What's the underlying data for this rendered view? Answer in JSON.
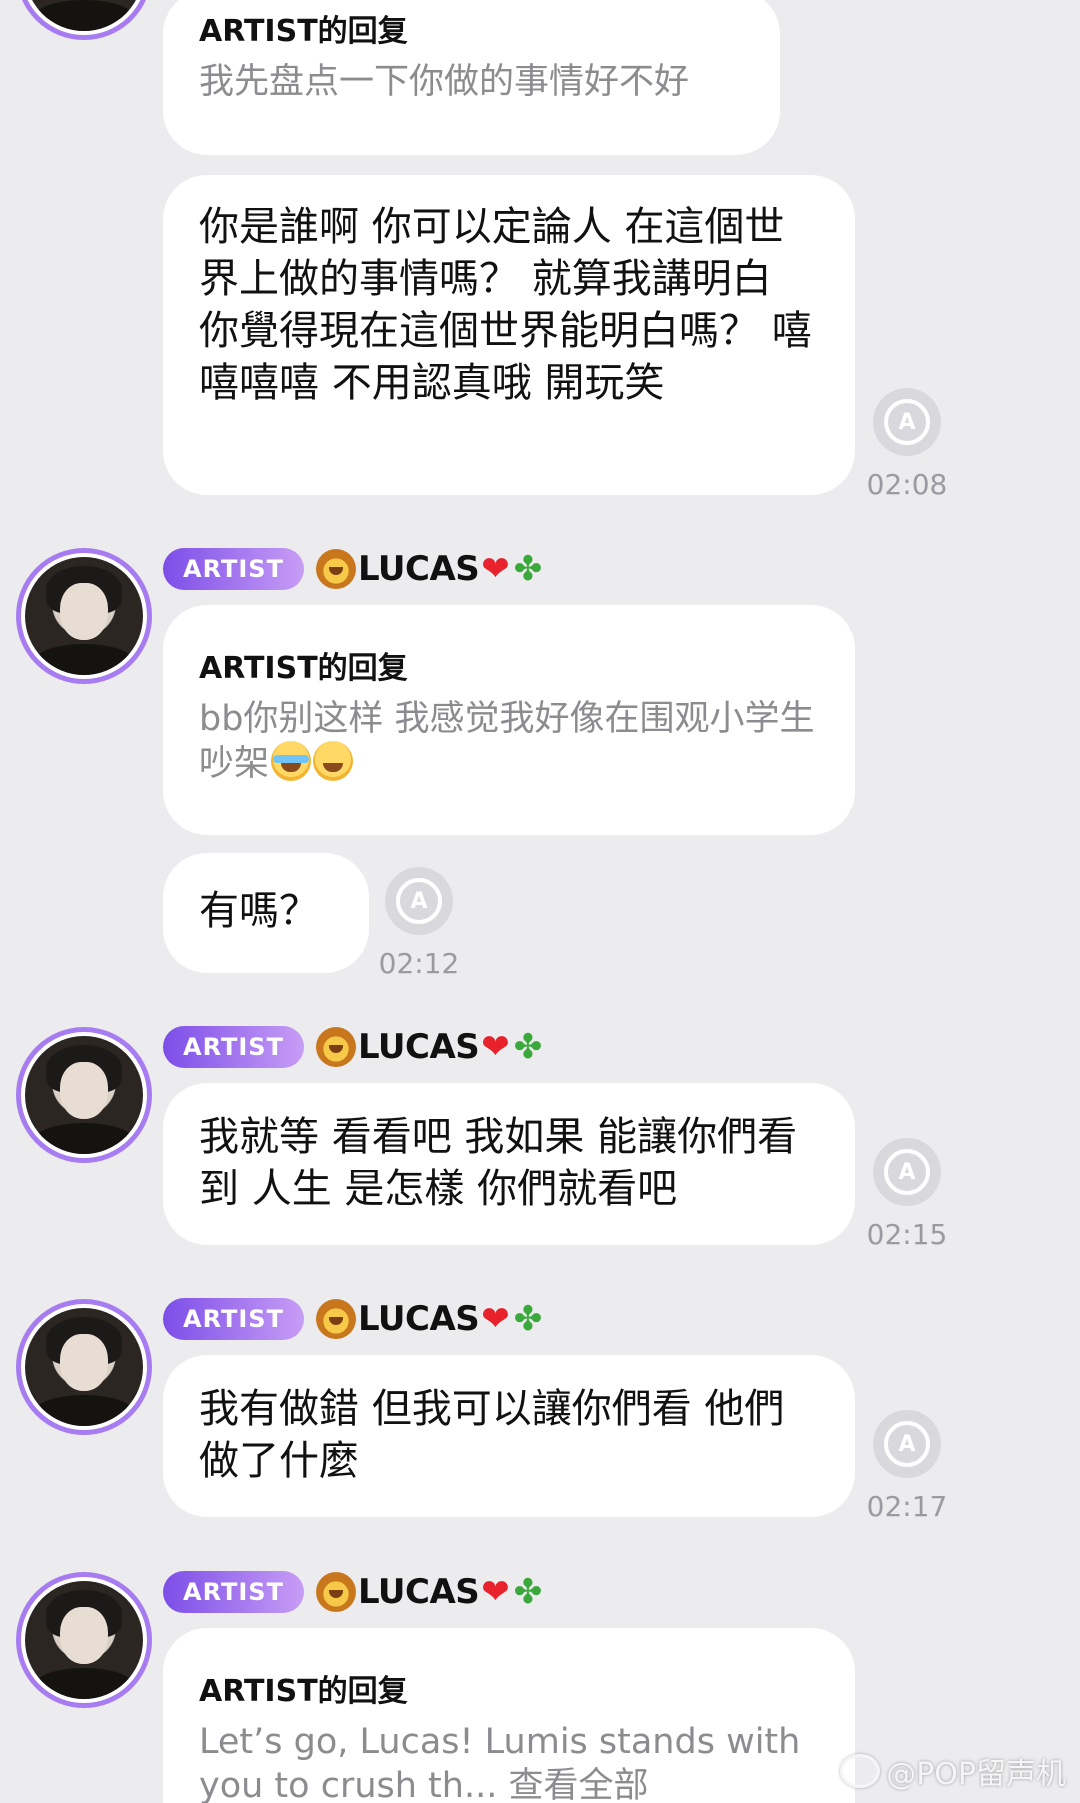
{
  "sender": {
    "badge": "ARTIST",
    "name": "LUCAS",
    "icons": [
      "lion-emoji",
      "red-heart-emoji",
      "four-leaf-clover-emoji"
    ],
    "avatar_ring_color": "#a77cf0"
  },
  "messages": [
    {
      "reply_title": "ARTIST的回复",
      "reply_body": "我先盘点一下你做的事情好不好"
    },
    {
      "text": "你是誰啊 你可以定論人 在這個世界上做的事情嗎？ 就算我講明白 你覺得現在這個世界能明白嗎？ 嘻嘻嘻嘻 不用認真哦 開玩笑",
      "time": "02:08"
    },
    {
      "reply_title": "ARTIST的回复",
      "reply_body": "bb你别这样 我感觉我好像在围观小学生吵架",
      "reply_emojis": [
        "face-with-tears-of-joy",
        "grinning-face-with-sweat"
      ]
    },
    {
      "text": "有嗎？",
      "time": "02:12"
    },
    {
      "text": "我就等 看看吧 我如果 能讓你們看到 人生 是怎樣 你們就看吧",
      "time": "02:15"
    },
    {
      "text": "我有做錯 但我可以讓你們看 他們做了什麼",
      "time": "02:17"
    },
    {
      "reply_title": "ARTIST的回复",
      "reply_body": "Let’s go, Lucas! Lumis stands with you to crush th...",
      "more_label": "查看全部"
    }
  ],
  "translate_icon_label": "A",
  "watermark": "@POP留声机"
}
